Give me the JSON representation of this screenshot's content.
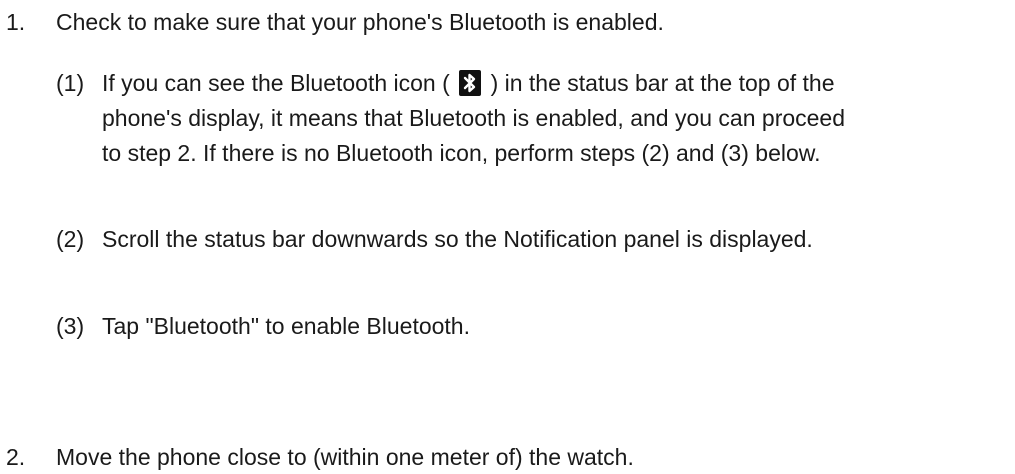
{
  "steps": [
    {
      "number": "1.",
      "text": "Check to make sure that your phone's Bluetooth is enabled.",
      "substeps": [
        {
          "number": "(1)",
          "line1_before_icon": "If you can see the Bluetooth icon (",
          "icon": "bluetooth-icon",
          "line1_after_icon": ") in the status bar at the top of the",
          "line2": "phone's display, it means that Bluetooth is enabled, and you can proceed",
          "line3": "to step 2. If there is no Bluetooth icon, perform steps (2) and (3) below."
        },
        {
          "number": "(2)",
          "text": "Scroll the status bar downwards so the Notification panel is displayed."
        },
        {
          "number": "(3)",
          "text": "Tap \"Bluetooth\" to enable Bluetooth."
        }
      ]
    },
    {
      "number": "2.",
      "text": "Move the phone close to (within one meter of) the watch."
    }
  ],
  "colors": {
    "text": "#1a1a1a",
    "icon_background": "#111111",
    "icon_glyph": "#ffffff"
  }
}
